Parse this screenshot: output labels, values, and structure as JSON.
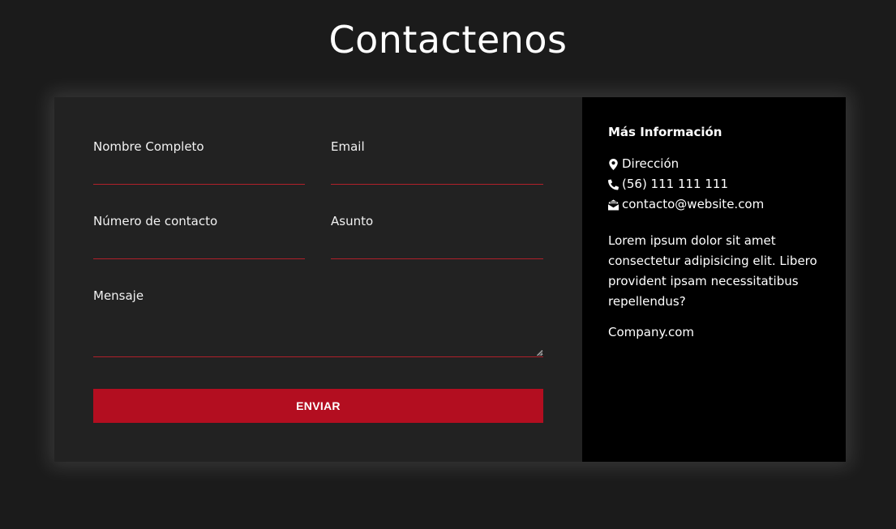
{
  "page": {
    "title": "Contactenos"
  },
  "form": {
    "fields": {
      "full_name": {
        "label": "Nombre Completo",
        "value": ""
      },
      "email": {
        "label": "Email",
        "value": ""
      },
      "phone": {
        "label": "Número de contacto",
        "value": ""
      },
      "subject": {
        "label": "Asunto",
        "value": ""
      },
      "message": {
        "label": "Mensaje",
        "value": ""
      }
    },
    "submit_label": "ENVIAR"
  },
  "info": {
    "heading": "Más Información",
    "address": {
      "icon": "map-marker-icon",
      "text": "Dirección"
    },
    "phone": {
      "icon": "phone-icon",
      "text": "(56) 111 111 111"
    },
    "email": {
      "icon": "envelope-open-icon",
      "text": "contacto@website.com"
    },
    "description": "Lorem ipsum dolor sit amet consectetur adipisicing elit. Libero provident ipsam necessitatibus repellendus?",
    "company": "Company.com"
  },
  "colors": {
    "background": "#1b1b1b",
    "form_panel": "#222222",
    "info_panel": "#000000",
    "accent": "#b30e20",
    "input_underline": "#b0202a"
  }
}
